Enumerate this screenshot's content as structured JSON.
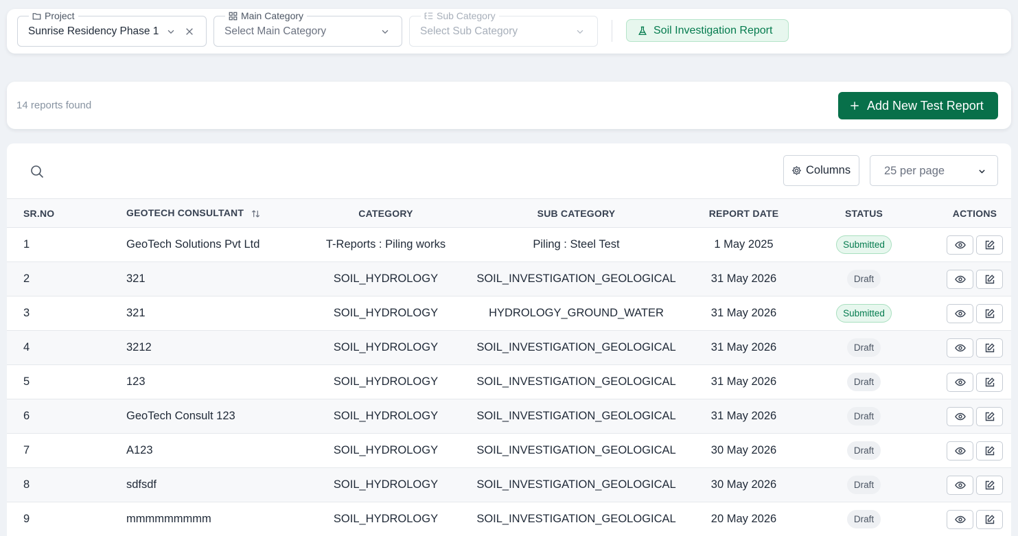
{
  "filters": {
    "project": {
      "legend": "Project",
      "value": "Sunrise Residency Phase 1"
    },
    "main_category": {
      "legend": "Main Category",
      "placeholder": "Select Main Category"
    },
    "sub_category": {
      "legend": "Sub Category",
      "placeholder": "Select Sub Category"
    },
    "report_type_chip": "Soil Investigation Report"
  },
  "summary": {
    "count_text": "14 reports found",
    "add_button_label": "Add New Test Report"
  },
  "toolbar": {
    "columns_label": "Columns",
    "per_page_value": "25 per page"
  },
  "table": {
    "headers": {
      "srno": "SR.NO",
      "consultant": "GEOTECH CONSULTANT",
      "category": "CATEGORY",
      "sub_category": "SUB CATEGORY",
      "report_date": "REPORT DATE",
      "status": "STATUS",
      "actions": "ACTIONS"
    },
    "rows": [
      {
        "srno": "1",
        "consultant": "GeoTech Solutions Pvt Ltd",
        "category": "T-Reports : Piling works",
        "sub_category": "Piling : Steel Test",
        "report_date": "1 May 2025",
        "status": "Submitted"
      },
      {
        "srno": "2",
        "consultant": "321",
        "category": "SOIL_HYDROLOGY",
        "sub_category": "SOIL_INVESTIGATION_GEOLOGICAL",
        "report_date": "31 May 2026",
        "status": "Draft"
      },
      {
        "srno": "3",
        "consultant": "321",
        "category": "SOIL_HYDROLOGY",
        "sub_category": "HYDROLOGY_GROUND_WATER",
        "report_date": "31 May 2026",
        "status": "Submitted"
      },
      {
        "srno": "4",
        "consultant": "3212",
        "category": "SOIL_HYDROLOGY",
        "sub_category": "SOIL_INVESTIGATION_GEOLOGICAL",
        "report_date": "31 May 2026",
        "status": "Draft"
      },
      {
        "srno": "5",
        "consultant": "123",
        "category": "SOIL_HYDROLOGY",
        "sub_category": "SOIL_INVESTIGATION_GEOLOGICAL",
        "report_date": "31 May 2026",
        "status": "Draft"
      },
      {
        "srno": "6",
        "consultant": "GeoTech Consult 123",
        "category": "SOIL_HYDROLOGY",
        "sub_category": "SOIL_INVESTIGATION_GEOLOGICAL",
        "report_date": "31 May 2026",
        "status": "Draft"
      },
      {
        "srno": "7",
        "consultant": "A123",
        "category": "SOIL_HYDROLOGY",
        "sub_category": "SOIL_INVESTIGATION_GEOLOGICAL",
        "report_date": "30 May 2026",
        "status": "Draft"
      },
      {
        "srno": "8",
        "consultant": "sdfsdf",
        "category": "SOIL_HYDROLOGY",
        "sub_category": "SOIL_INVESTIGATION_GEOLOGICAL",
        "report_date": "30 May 2026",
        "status": "Draft"
      },
      {
        "srno": "9",
        "consultant": "mmmmmmmmm",
        "category": "SOIL_HYDROLOGY",
        "sub_category": "SOIL_INVESTIGATION_GEOLOGICAL",
        "report_date": "20 May 2026",
        "status": "Draft"
      }
    ]
  },
  "icons": {
    "project": "folder-icon",
    "main_category": "grid-icon",
    "sub_category": "list-tree-icon",
    "chip": "flask-icon",
    "search": "search-icon",
    "columns": "gear-icon",
    "view": "eye-icon",
    "edit": "edit-icon"
  },
  "colors": {
    "primary": "#08704a",
    "submitted_bg": "#e7f7ee",
    "submitted_text": "#047b4e",
    "draft_bg": "#eef0f3",
    "page_bg": "#eff2f6"
  }
}
